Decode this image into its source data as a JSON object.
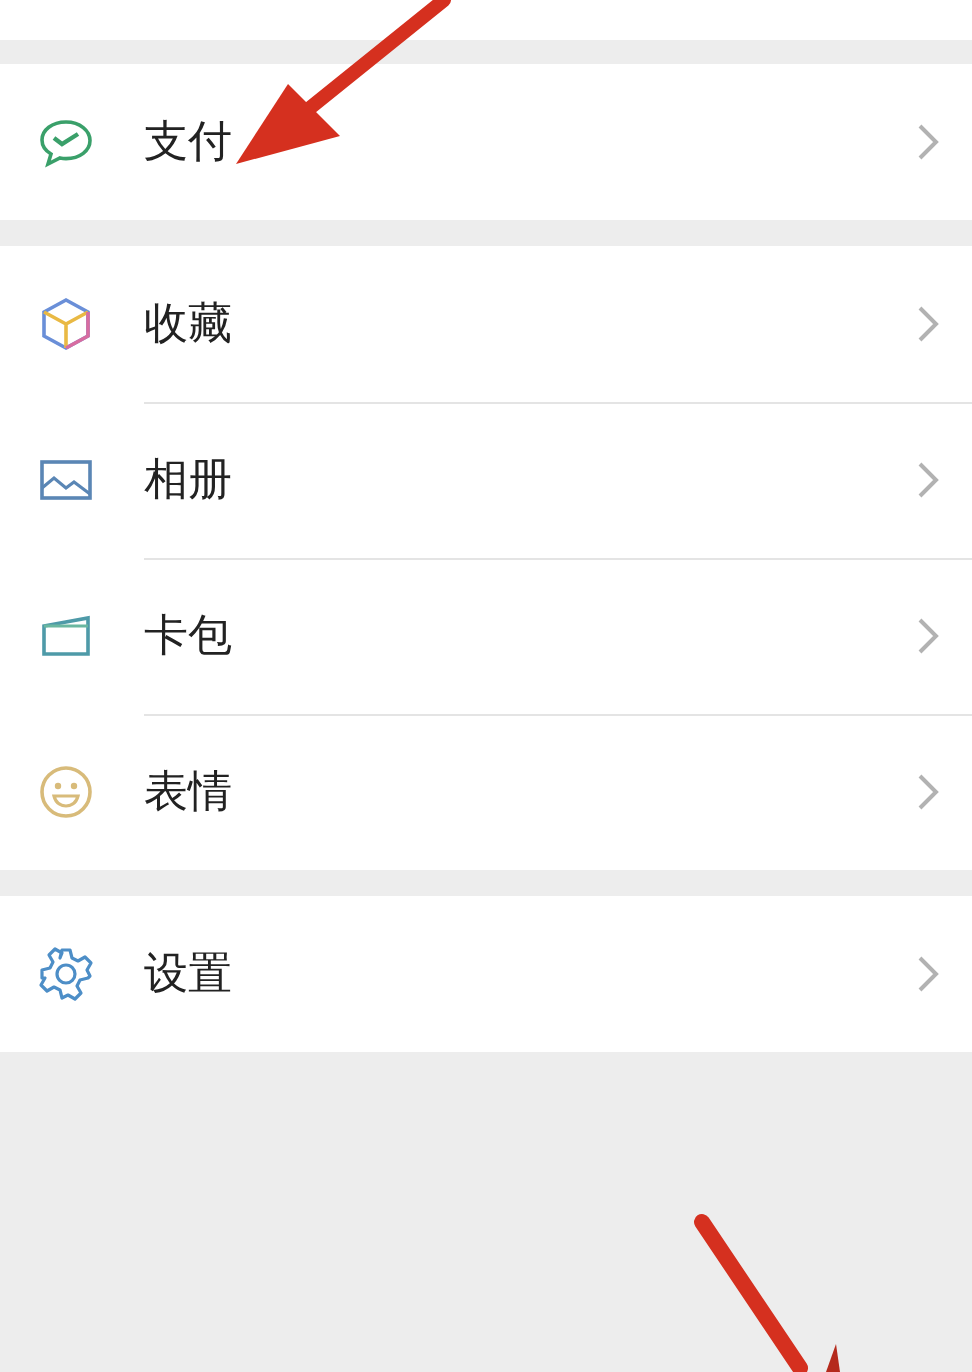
{
  "sections": [
    {
      "items": [
        {
          "kind": "pay",
          "label": "支付"
        }
      ]
    },
    {
      "items": [
        {
          "kind": "favorites",
          "label": "收藏"
        },
        {
          "kind": "album",
          "label": "相册"
        },
        {
          "kind": "cards",
          "label": "卡包"
        },
        {
          "kind": "stickers",
          "label": "表情"
        }
      ]
    },
    {
      "items": [
        {
          "kind": "settings",
          "label": "设置"
        }
      ]
    }
  ]
}
